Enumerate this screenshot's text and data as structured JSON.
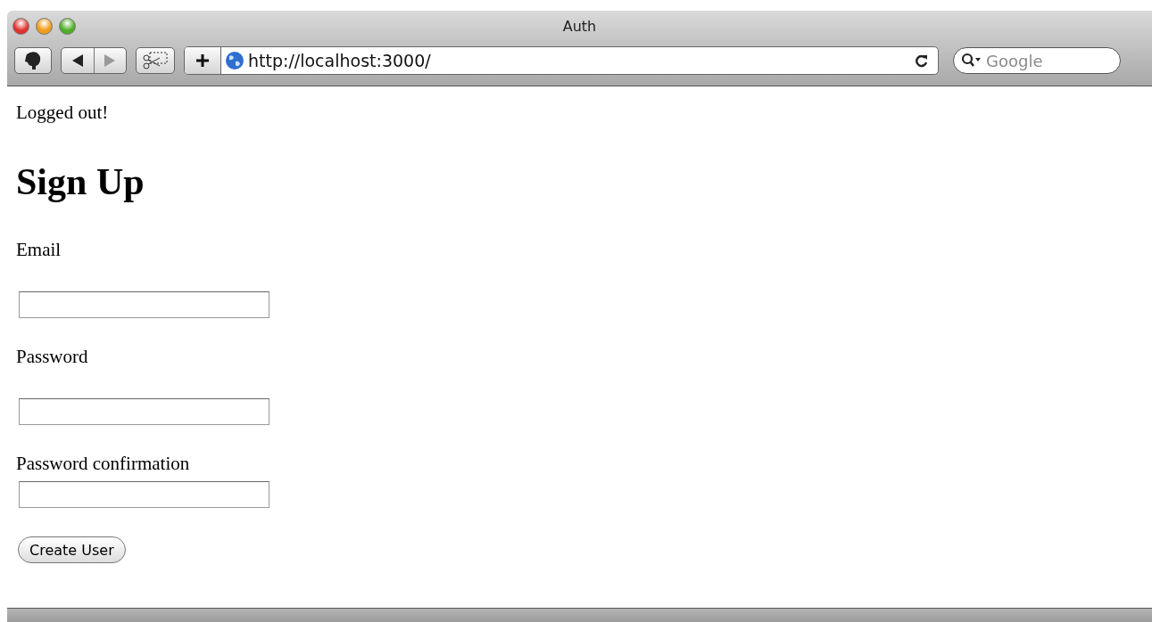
{
  "window": {
    "title": "Auth"
  },
  "toolbar": {
    "url": "http://localhost:3000/",
    "search": {
      "placeholder": "Google"
    }
  },
  "page": {
    "flash": "Logged out!",
    "heading": "Sign Up",
    "fields": [
      {
        "label": "Email",
        "kind": "spaced"
      },
      {
        "label": "Password",
        "kind": "spaced"
      },
      {
        "label": "Password confirmation",
        "kind": "tight"
      }
    ],
    "submit": "Create User"
  }
}
